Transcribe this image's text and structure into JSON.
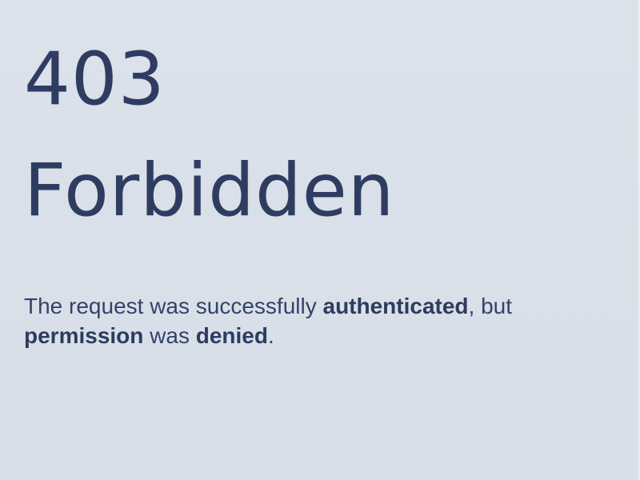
{
  "error": {
    "code": "403",
    "title": "Forbidden"
  },
  "message": {
    "part1": "The request was successfully ",
    "auth": "authenticated",
    "part2": ", but",
    "permission": "permission",
    "part3": " was ",
    "denied": "denied",
    "part4": "."
  },
  "colors": {
    "background": "#d9dfe7",
    "text": "#2e3b60"
  }
}
